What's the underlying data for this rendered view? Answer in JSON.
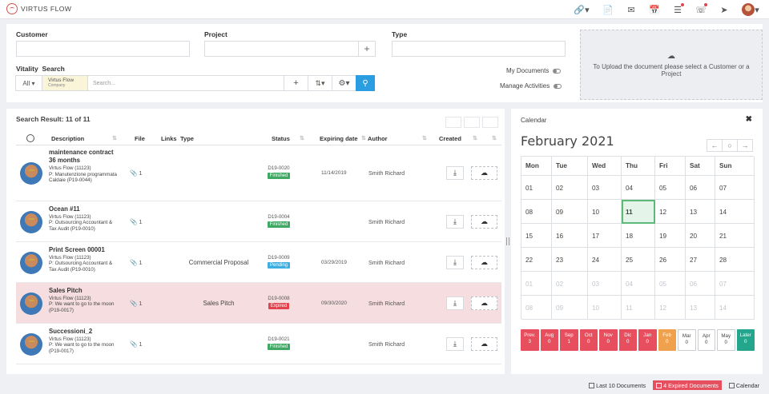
{
  "app": {
    "name": "VIRTUS FLOW"
  },
  "topbar": {
    "icons": [
      "link-icon",
      "document-icon",
      "mail-icon",
      "calendar-icon",
      "tasks-icon",
      "support-icon",
      "rocket-icon"
    ]
  },
  "filters": {
    "customer_label": "Customer",
    "project_label": "Project",
    "type_label": "Type",
    "vitality_label": "Vitality",
    "search_label": "Search",
    "all_option": "All",
    "company_chip": {
      "name": "Virtus Flow",
      "kind": "Company"
    },
    "search_placeholder": "Search...",
    "my_documents": "My Documents",
    "manage_activities": "Manage Activities"
  },
  "upload": {
    "text": "To Upload the document please select a Customer or a Project"
  },
  "results": {
    "title": "Search Result: 11 of 11",
    "columns": {
      "description": "Description",
      "file": "File",
      "links": "Links",
      "type": "Type",
      "status": "Status",
      "expiring": "Expiring date",
      "author": "Author",
      "created": "Created"
    },
    "rows": [
      {
        "title": "maintenance contract 36 months",
        "company": "Virtus Flow (11123)",
        "project": "P: Manutenzione programmata Caldaie (P19-0044)",
        "files": "1",
        "type": "",
        "code": "D19-0020",
        "status": "Finished",
        "status_color": "#3fa964",
        "expiring": "11/14/2019",
        "author": "Smith Richard"
      },
      {
        "title": "Ocean #11",
        "company": "Virtus Flow (11123)",
        "project": "P: Outsourcing Accountant & Tax Audit (P19-0010)",
        "files": "1",
        "type": "",
        "code": "D19-0004",
        "status": "Finished",
        "status_color": "#3fa964",
        "expiring": "",
        "author": "Smith Richard"
      },
      {
        "title": "Print Screen 00001",
        "company": "Virtus Flow (11123)",
        "project": "P: Outsourcing Accountant & Tax Audit (P19-0010)",
        "files": "1",
        "type": "Commercial Proposal",
        "code": "D19-0009",
        "status": "Pending",
        "status_color": "#3daee0",
        "expiring": "03/29/2019",
        "author": "Smith Richard"
      },
      {
        "title": "Sales Pitch",
        "company": "Virtus Flow (11123)",
        "project": "P: We want to go to the moon (P19-0017)",
        "files": "1",
        "type": "Sales Pitch",
        "code": "D19-0008",
        "status": "Expired",
        "status_color": "#e0454f",
        "expiring": "09/30/2020",
        "author": "Smith Richard"
      },
      {
        "title": "Successioni_2",
        "company": "Virtus Flow (11123)",
        "project": "P: We want to go to the moon (P19-0017)",
        "files": "1",
        "type": "",
        "code": "D19-0021",
        "status": "Finished",
        "status_color": "#3fa964",
        "expiring": "",
        "author": "Smith Richard"
      }
    ]
  },
  "calendar": {
    "label": "Calendar",
    "month": "February 2021",
    "days": [
      "Mon",
      "Tue",
      "Wed",
      "Thu",
      "Fri",
      "Sat",
      "Sun"
    ],
    "weeks": [
      [
        "01",
        "02",
        "03",
        "04",
        "05",
        "06",
        "07"
      ],
      [
        "08",
        "09",
        "10",
        "11",
        "12",
        "13",
        "14"
      ],
      [
        "15",
        "16",
        "17",
        "18",
        "19",
        "20",
        "21"
      ],
      [
        "22",
        "23",
        "24",
        "25",
        "26",
        "27",
        "28"
      ],
      [
        "01",
        "02",
        "03",
        "04",
        "05",
        "06",
        "07"
      ],
      [
        "08",
        "09",
        "10",
        "11",
        "12",
        "13",
        "14"
      ]
    ],
    "today": "11",
    "months": [
      {
        "label": "Prev.",
        "count": "3",
        "style": "red"
      },
      {
        "label": "Aug",
        "count": "0",
        "style": "red"
      },
      {
        "label": "Sep",
        "count": "1",
        "style": "red"
      },
      {
        "label": "Oct",
        "count": "0",
        "style": "red"
      },
      {
        "label": "Nov",
        "count": "0",
        "style": "red"
      },
      {
        "label": "Dic",
        "count": "0",
        "style": "red"
      },
      {
        "label": "Jan",
        "count": "0",
        "style": "red"
      },
      {
        "label": "Feb",
        "count": "0",
        "style": "orange"
      },
      {
        "label": "Mar",
        "count": "0",
        "style": "white"
      },
      {
        "label": "Apr",
        "count": "0",
        "style": "white"
      },
      {
        "label": "May",
        "count": "0",
        "style": "white"
      },
      {
        "label": "Later",
        "count": "0",
        "style": "teal"
      }
    ]
  },
  "footer": {
    "last10": "Last 10 Documents",
    "expired": "4 Expired Documents",
    "calendar": "Calendar"
  }
}
